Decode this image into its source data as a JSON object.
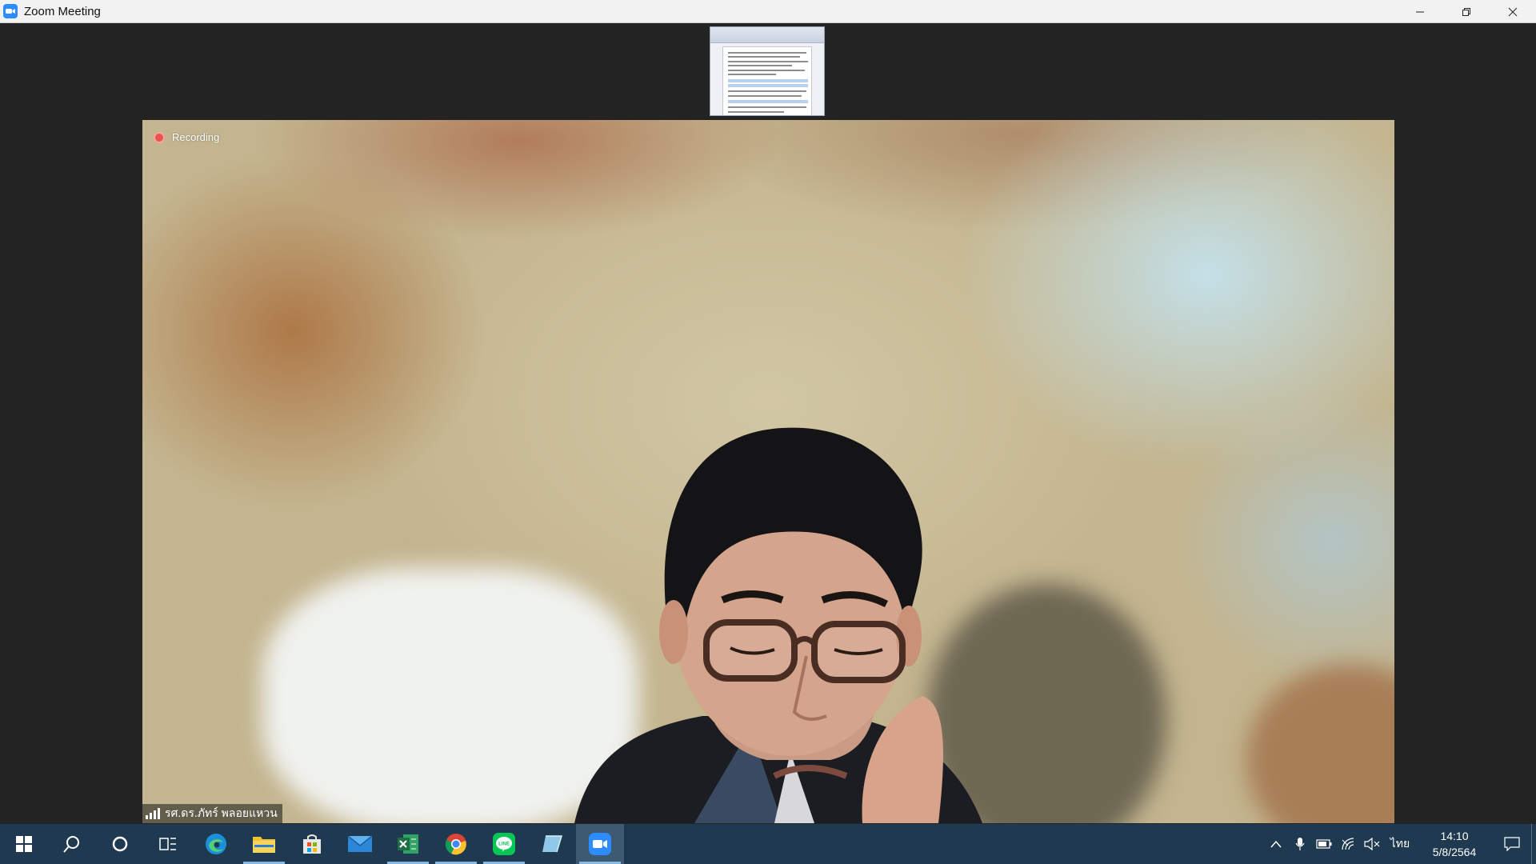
{
  "window": {
    "title": "Zoom Meeting",
    "controls": [
      "minimize",
      "restore",
      "close"
    ]
  },
  "meeting": {
    "recording_label": "Recording",
    "participant_name": "รศ.ดร.ภัทร์ พลอยแหวน"
  },
  "shared_screen": {
    "description_icon": "document-thumbnail"
  },
  "taskbar": {
    "apps": [
      {
        "name": "start",
        "icon": "windows-logo"
      },
      {
        "name": "search",
        "icon": "search-icon"
      },
      {
        "name": "cortana",
        "icon": "circle-icon"
      },
      {
        "name": "task-view",
        "icon": "task-view-icon"
      },
      {
        "name": "edge",
        "icon": "edge-icon"
      },
      {
        "name": "file-explorer",
        "icon": "folder-icon"
      },
      {
        "name": "store",
        "icon": "store-icon"
      },
      {
        "name": "mail",
        "icon": "mail-icon"
      },
      {
        "name": "excel",
        "icon": "excel-icon"
      },
      {
        "name": "chrome",
        "icon": "chrome-icon"
      },
      {
        "name": "line",
        "icon": "line-icon"
      },
      {
        "name": "notepad",
        "icon": "notepad-icon"
      },
      {
        "name": "zoom",
        "icon": "zoom-icon"
      }
    ],
    "tray": {
      "language": "ไทย",
      "time": "14:10",
      "date": "5/8/2564"
    }
  },
  "colors": {
    "taskbar_bg": "#1f3a50",
    "zoom_blue": "#2d8cff",
    "recording_red": "#e8544b"
  }
}
